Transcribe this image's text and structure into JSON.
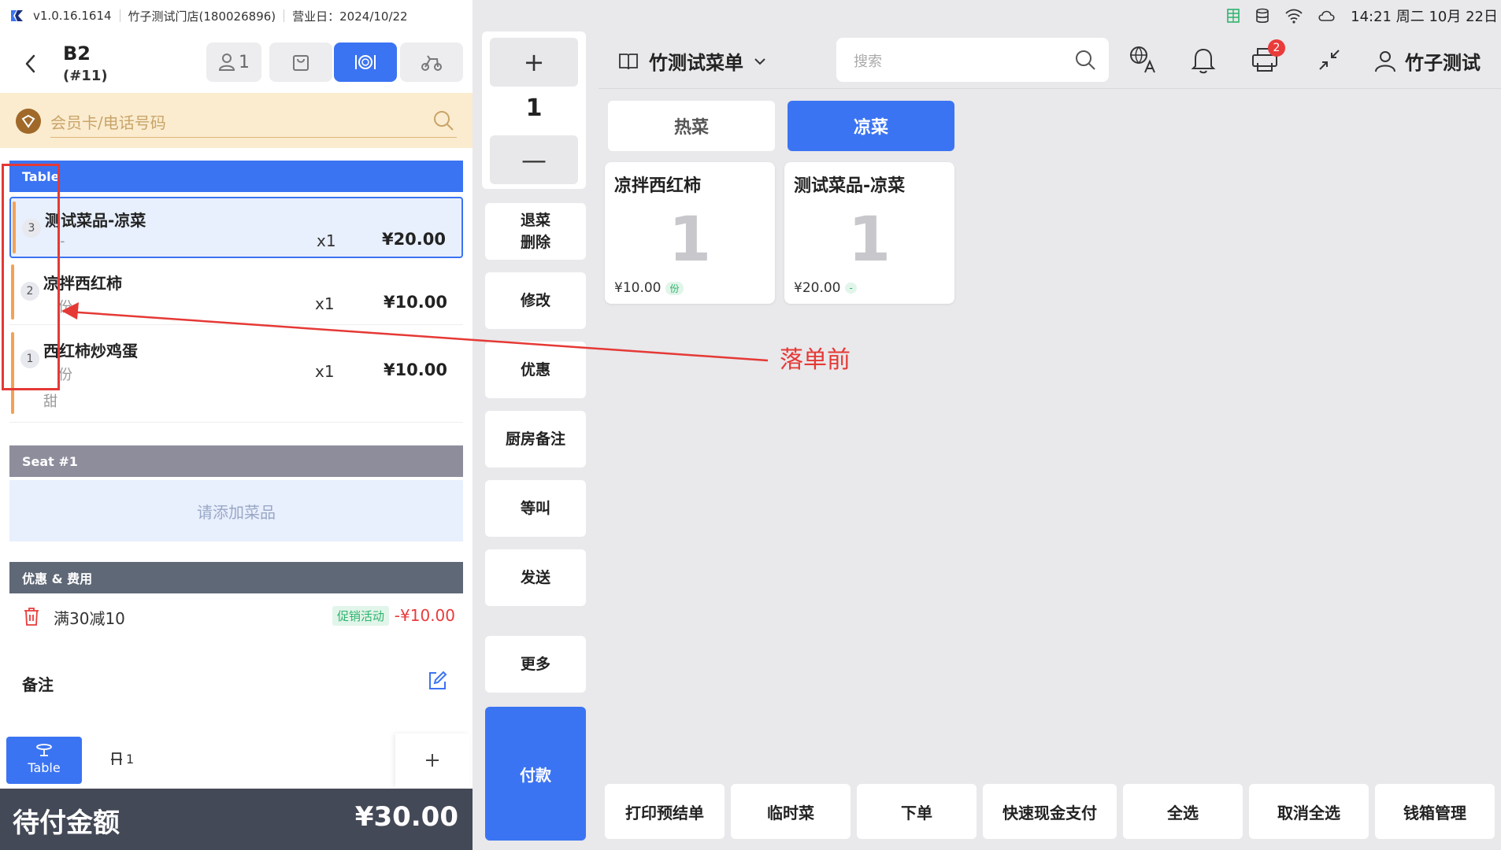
{
  "app": {
    "version": "v1.0.16.1614",
    "store": "竹子测试门店(180026896)",
    "business_day": "营业日：2024/10/22"
  },
  "status_bar": {
    "time": "14:21 周二 10月 22日"
  },
  "order": {
    "table": "B2",
    "order_no": "(#11)",
    "guests": "1"
  },
  "member": {
    "placeholder": "会员卡/电话号码"
  },
  "groups": {
    "table": "Table",
    "seat": "Seat #1",
    "discount": "优惠 & 费用"
  },
  "items": [
    {
      "index": "3",
      "name": "测试菜品-凉菜",
      "spec": "-",
      "extra": "",
      "qty": "x1",
      "price": "¥20.00"
    },
    {
      "index": "2",
      "name": "凉拌西红柿",
      "spec": "份",
      "extra": "",
      "qty": "x1",
      "price": "¥10.00"
    },
    {
      "index": "1",
      "name": "西红柿炒鸡蛋",
      "spec": "份",
      "extra": "甜",
      "qty": "x1",
      "price": "¥10.00"
    }
  ],
  "seat_empty": "请添加菜品",
  "discount": {
    "name": "满30减10",
    "tag": "促销活动",
    "amount": "-¥10.00"
  },
  "note_label": "备注",
  "bottom_tabs": {
    "table": "Table",
    "seat_count": "1"
  },
  "total": {
    "label": "待付金额",
    "value": "¥30.00"
  },
  "quantity": {
    "plus": "+",
    "value": "1",
    "minus": "—"
  },
  "actions": {
    "return_line1": "退菜",
    "return_line2": "删除",
    "modify": "修改",
    "discount": "优惠",
    "kitchen_note": "厨房备注",
    "hold": "等叫",
    "send": "发送",
    "more": "更多",
    "pay": "付款"
  },
  "menu": {
    "title": "竹测试菜单",
    "search_placeholder": "搜索",
    "notify_badge": "2",
    "user": "竹子测试",
    "categories": [
      "热菜",
      "凉菜"
    ],
    "active_category": "凉菜",
    "dishes": [
      {
        "name": "凉拌西红柿",
        "count": "1",
        "price": "¥10.00",
        "unit": "份"
      },
      {
        "name": "测试菜品-凉菜",
        "count": "1",
        "price": "¥20.00",
        "unit": "-"
      }
    ]
  },
  "footer_buttons": [
    "打印预结单",
    "临时菜",
    "下单",
    "快速现金支付",
    "全选",
    "取消全选",
    "钱箱管理"
  ],
  "annotation": "落单前",
  "colors": {
    "primary": "#3b74f2",
    "accent_orange": "#f2a255",
    "danger": "#ea3b3b",
    "success": "#2eb36c",
    "member_bg": "#fbeccf"
  }
}
